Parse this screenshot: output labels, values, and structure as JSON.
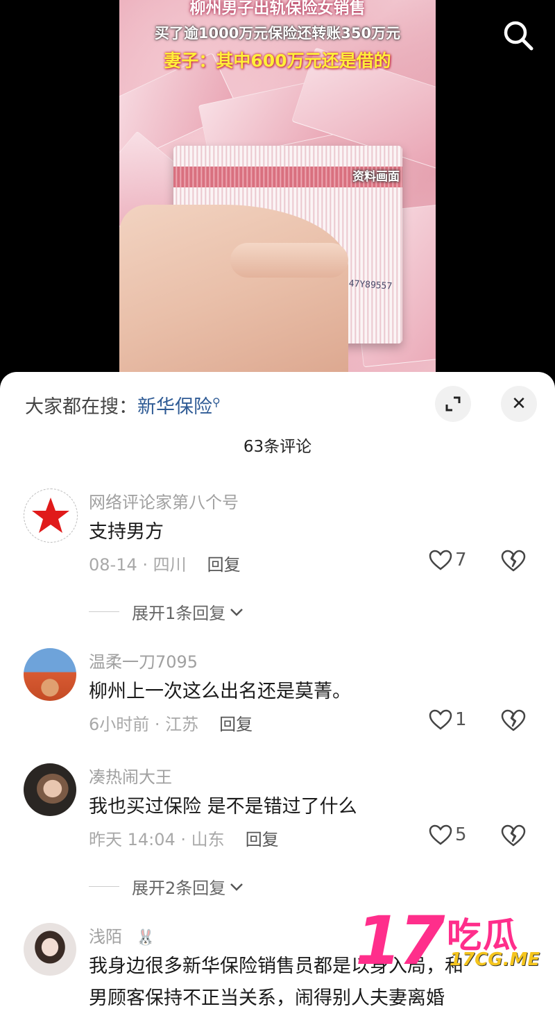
{
  "video": {
    "headline_1": "柳州男子出轨保险女销售",
    "headline_2": "买了逾1000万元保险还转账350万元",
    "headline_3": "妻子：其中600万元还是借的",
    "material_label": "资料画面",
    "serial": "MD47Y89557",
    "search_icon": "search-icon"
  },
  "sheet": {
    "hot_search_label": "大家都在搜：",
    "hot_search_term": "新华保险",
    "comment_count": "63条评论",
    "expand_icon": "expand-icon",
    "close_label": "✕"
  },
  "comments": [
    {
      "username": "网络评论家第八个号",
      "text": "支持男方",
      "date": "08-14 · 四川",
      "reply": "回复",
      "likes": "7",
      "expand": "展开1条回复"
    },
    {
      "username": "温柔一刀7095",
      "text": "柳州上一次这么出名还是莫菁。",
      "date": "6小时前 · 江苏",
      "reply": "回复",
      "likes": "1"
    },
    {
      "username": "凑热闹大王",
      "text": "我也买过保险 是不是错过了什么",
      "date": "昨天 14:04 · 山东",
      "reply": "回复",
      "likes": "5",
      "expand": "展开2条回复"
    },
    {
      "username": "浅陌",
      "badge": "🐰",
      "text": "我身边很多新华保险销售员都是以身入局，和",
      "text2": "男顾客保持不正当关系，闹得别人夫妻离婚"
    }
  ],
  "watermark": {
    "number": "17",
    "cn": "吃瓜",
    "url": "17CG.ME"
  },
  "colors": {
    "accent_link": "#2f5b95",
    "watermark_pink": "#ff2e8b",
    "watermark_yellow": "#f5c51e"
  }
}
